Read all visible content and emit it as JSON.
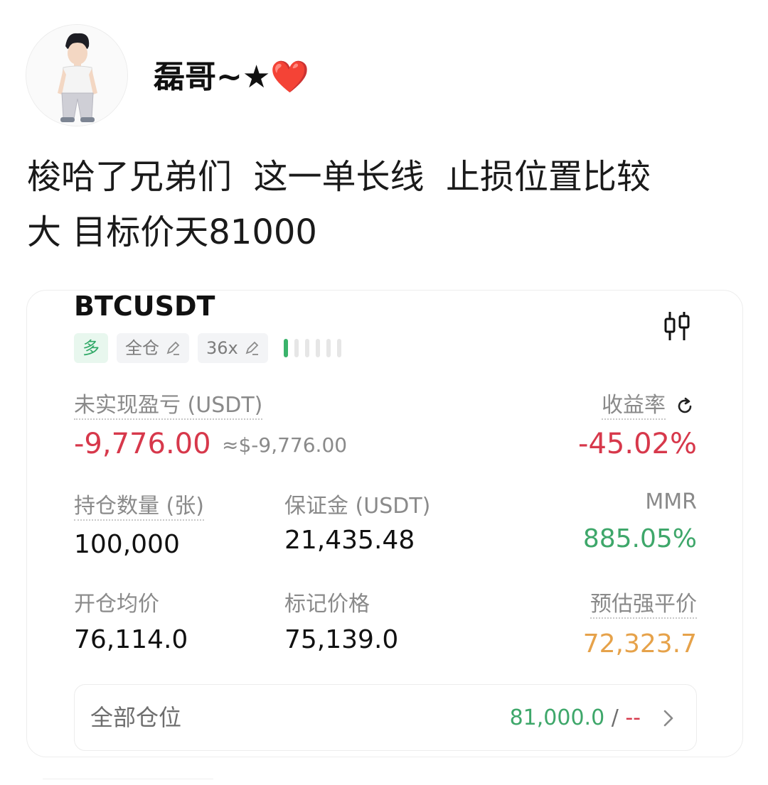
{
  "post": {
    "username": "磊哥~★❤️",
    "text_lines": [
      "梭哈了兄弟们  这一单长线  止损位置比较",
      "大 目标价天81000"
    ]
  },
  "card": {
    "symbol": "BTCUSDT",
    "chart_icon": "candlestick-icon",
    "tags": {
      "side": "多",
      "margin_mode": "全仓",
      "leverage": "36x"
    },
    "risk_bars": {
      "active": 1,
      "total": 6
    },
    "pnl": {
      "label": "未实现盈亏 (USDT)",
      "value": "-9,776.00",
      "approx": "≈$-9,776.00"
    },
    "roi": {
      "label": "收益率",
      "value": "-45.02%",
      "icon": "refresh-icon"
    },
    "size": {
      "label": "持仓数量 (张)",
      "value": "100,000"
    },
    "margin": {
      "label": "保证金 (USDT)",
      "value": "21,435.48"
    },
    "mmr": {
      "label": "MMR",
      "value": "885.05%"
    },
    "entry_price": {
      "label": "开仓均价",
      "value": "76,114.0"
    },
    "mark_price": {
      "label": "标记价格",
      "value": "75,139.0"
    },
    "liq_price": {
      "label": "预估强平价",
      "value": "72,323.7"
    },
    "all_positions": {
      "label": "全部仓位",
      "take_profit": "81,000.0",
      "separator": " / ",
      "stop_loss": "--"
    }
  },
  "colors": {
    "loss_red": "#d7384b",
    "profit_green": "#3ea76a",
    "liq_orange": "#e6a24a",
    "long_tag_green": "#2fa866"
  }
}
